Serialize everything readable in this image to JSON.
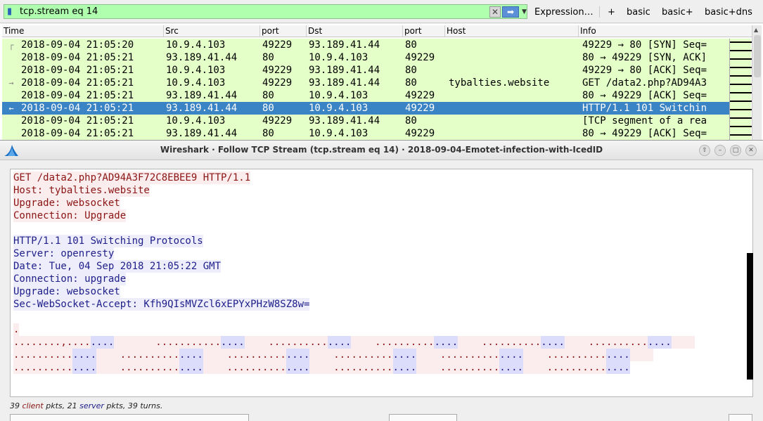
{
  "filter": {
    "value": "tcp.stream eq 14",
    "clear_icon": "x-icon",
    "apply_icon": "arrow-right-icon"
  },
  "toolbar": {
    "expression_label": "Expression…",
    "plus_label": "+",
    "buttons": [
      "basic",
      "basic+",
      "basic+dns"
    ]
  },
  "packet_list": {
    "columns": [
      "Time",
      "Src",
      "port",
      "Dst",
      "port",
      "Host",
      "Info"
    ],
    "rows": [
      {
        "rel": "┌",
        "time": "2018-09-04 21:05:20",
        "src": "10.9.4.103",
        "sport": "49229",
        "dst": "93.189.41.44",
        "dport": "80",
        "host": "",
        "info": "49229 → 80 [SYN] Seq=",
        "selected": false
      },
      {
        "rel": "",
        "time": "2018-09-04 21:05:21",
        "src": "93.189.41.44",
        "sport": "80",
        "dst": "10.9.4.103",
        "dport": "49229",
        "host": "",
        "info": "80 → 49229 [SYN, ACK]",
        "selected": false
      },
      {
        "rel": "",
        "time": "2018-09-04 21:05:21",
        "src": "10.9.4.103",
        "sport": "49229",
        "dst": "93.189.41.44",
        "dport": "80",
        "host": "",
        "info": "49229 → 80 [ACK] Seq=",
        "selected": false
      },
      {
        "rel": "→",
        "time": "2018-09-04 21:05:21",
        "src": "10.9.4.103",
        "sport": "49229",
        "dst": "93.189.41.44",
        "dport": "80",
        "host": "tybalties.website",
        "info": "GET /data2.php?AD94A3",
        "selected": false
      },
      {
        "rel": "",
        "time": "2018-09-04 21:05:21",
        "src": "93.189.41.44",
        "sport": "80",
        "dst": "10.9.4.103",
        "dport": "49229",
        "host": "",
        "info": "80 → 49229 [ACK] Seq=",
        "selected": false
      },
      {
        "rel": "←",
        "time": "2018-09-04 21:05:21",
        "src": "93.189.41.44",
        "sport": "80",
        "dst": "10.9.4.103",
        "dport": "49229",
        "host": "",
        "info": "HTTP/1.1 101 Switchin",
        "selected": true
      },
      {
        "rel": "",
        "time": "2018-09-04 21:05:21",
        "src": "10.9.4.103",
        "sport": "49229",
        "dst": "93.189.41.44",
        "dport": "80",
        "host": "",
        "info": "[TCP segment of a rea",
        "selected": false
      },
      {
        "rel": "",
        "time": "2018-09-04 21:05:21",
        "src": "93.189.41.44",
        "sport": "80",
        "dst": "10.9.4.103",
        "dport": "49229",
        "host": "",
        "info": "80 → 49229 [ACK] Seq=",
        "selected": false
      }
    ]
  },
  "dialog": {
    "title": "Wireshark · Follow TCP Stream (tcp.stream eq 14) · 2018-09-04-Emotet-infection-with-IcedID",
    "logo_icon": "wireshark-fin-icon",
    "window_buttons": [
      "up-icon",
      "minimize-icon",
      "maximize-icon",
      "close-icon"
    ],
    "stream_lines": [
      {
        "dir": "client",
        "text": "GET /data2.php?AD94A3F72C8EBEE9 HTTP/1.1"
      },
      {
        "dir": "client",
        "text": "Host: tybalties.website"
      },
      {
        "dir": "client",
        "text": "Upgrade: websocket"
      },
      {
        "dir": "client",
        "text": "Connection: Upgrade"
      },
      {
        "dir": "blank",
        "text": ""
      },
      {
        "dir": "server",
        "text": "HTTP/1.1 101 Switching Protocols"
      },
      {
        "dir": "server",
        "text": "Server: openresty"
      },
      {
        "dir": "server",
        "text": "Date: Tue, 04 Sep 2018 21:05:22 GMT"
      },
      {
        "dir": "server",
        "text": "Connection: upgrade"
      },
      {
        "dir": "server",
        "text": "Upgrade: websocket"
      },
      {
        "dir": "server",
        "text": "Sec-WebSocket-Accept: Kfh9QIsMVZcl6xEPYxPHzW8SZ8w="
      },
      {
        "dir": "blank",
        "text": ""
      },
      {
        "dir": "client",
        "text": "."
      }
    ],
    "binary_lines": [
      [
        {
          "dir": "client",
          "text": "........,...."
        },
        {
          "dir": "server",
          "text": "...."
        },
        {
          "dir": "client",
          "text": "       ..........."
        },
        {
          "dir": "server",
          "text": "...."
        },
        {
          "dir": "client",
          "text": "    .........."
        },
        {
          "dir": "server",
          "text": "...."
        },
        {
          "dir": "client",
          "text": "    .........."
        },
        {
          "dir": "server",
          "text": "...."
        },
        {
          "dir": "client",
          "text": "    .........."
        },
        {
          "dir": "server",
          "text": "...."
        },
        {
          "dir": "client",
          "text": "    .........."
        },
        {
          "dir": "server",
          "text": "...."
        },
        {
          "dir": "client",
          "text": "    "
        }
      ],
      [
        {
          "dir": "client",
          "text": ".........."
        },
        {
          "dir": "server",
          "text": "...."
        },
        {
          "dir": "client",
          "text": "    .........."
        },
        {
          "dir": "server",
          "text": "...."
        },
        {
          "dir": "client",
          "text": "    .........."
        },
        {
          "dir": "server",
          "text": "...."
        },
        {
          "dir": "client",
          "text": "    .........."
        },
        {
          "dir": "server",
          "text": "...."
        },
        {
          "dir": "client",
          "text": "    .........."
        },
        {
          "dir": "server",
          "text": "...."
        },
        {
          "dir": "client",
          "text": "    .........."
        },
        {
          "dir": "server",
          "text": "...."
        },
        {
          "dir": "client",
          "text": "    "
        }
      ],
      [
        {
          "dir": "client",
          "text": ".........."
        },
        {
          "dir": "server",
          "text": "...."
        },
        {
          "dir": "client",
          "text": "    .........."
        },
        {
          "dir": "server",
          "text": "...."
        },
        {
          "dir": "client",
          "text": "    .........."
        },
        {
          "dir": "server",
          "text": "...."
        },
        {
          "dir": "client",
          "text": "    .........."
        },
        {
          "dir": "server",
          "text": "...."
        },
        {
          "dir": "client",
          "text": "    .........."
        },
        {
          "dir": "server",
          "text": "...."
        },
        {
          "dir": "client",
          "text": "    .........."
        },
        {
          "dir": "server",
          "text": "...."
        }
      ]
    ],
    "status": {
      "client_count": "39",
      "client_word": "client",
      "mid1": " pkts, ",
      "server_count": "21",
      "server_word": "server",
      "end": " pkts, 39 turns."
    }
  },
  "colors": {
    "filter_bg": "#afffaf",
    "row_bg": "#e4ffc7",
    "selected_bg": "#3a83c4",
    "client_fg": "#8b1414",
    "client_bg": "#fbeded",
    "server_fg": "#20208b",
    "server_bg": "#ededfb"
  }
}
